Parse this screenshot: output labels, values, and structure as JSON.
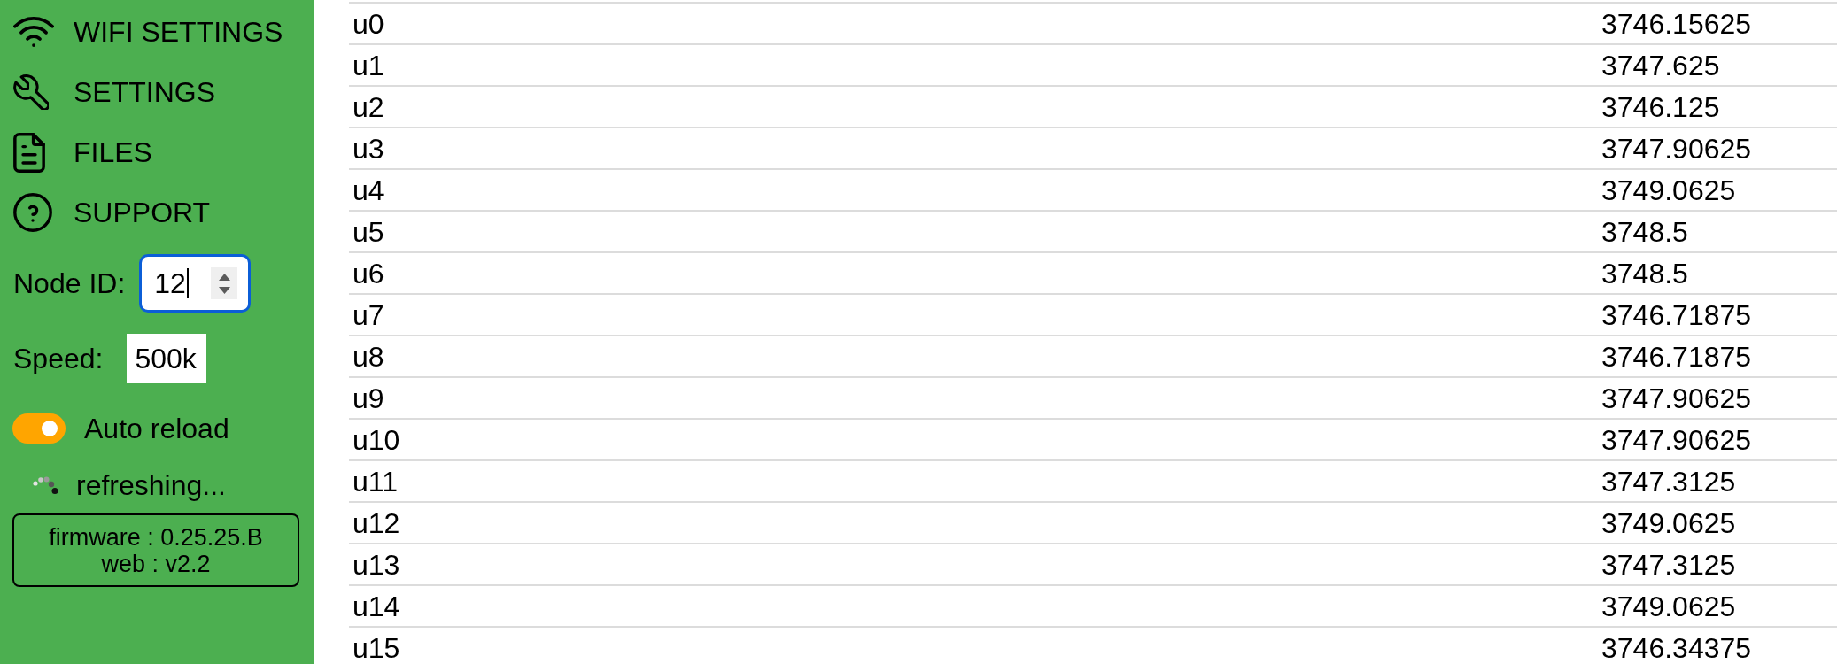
{
  "sidebar": {
    "nav_items": [
      {
        "kind": "wifi",
        "label": "WIFI SETTINGS"
      },
      {
        "kind": "wrench",
        "label": "SETTINGS"
      },
      {
        "kind": "document",
        "label": "FILES"
      },
      {
        "kind": "help",
        "label": "SUPPORT"
      }
    ],
    "node_id": {
      "label": "Node ID:",
      "value": "12",
      "focused": true
    },
    "speed": {
      "label": "Speed:",
      "value": "500k"
    },
    "auto_reload": {
      "label": "Auto reload",
      "on": true
    },
    "status": {
      "text": "refreshing..."
    },
    "version_box": {
      "lines": [
        "firmware : 0.25.25.B",
        "web : v2.2"
      ]
    }
  },
  "table": {
    "rows": [
      {
        "cells": [
          "u0",
          "3746.15625"
        ]
      },
      {
        "cells": [
          "u1",
          "3747.625"
        ]
      },
      {
        "cells": [
          "u2",
          "3746.125"
        ]
      },
      {
        "cells": [
          "u3",
          "3747.90625"
        ]
      },
      {
        "cells": [
          "u4",
          "3749.0625"
        ]
      },
      {
        "cells": [
          "u5",
          "3748.5"
        ]
      },
      {
        "cells": [
          "u6",
          "3748.5"
        ]
      },
      {
        "cells": [
          "u7",
          "3746.71875"
        ]
      },
      {
        "cells": [
          "u8",
          "3746.71875"
        ]
      },
      {
        "cells": [
          "u9",
          "3747.90625"
        ]
      },
      {
        "cells": [
          "u10",
          "3747.90625"
        ]
      },
      {
        "cells": [
          "u11",
          "3747.3125"
        ]
      },
      {
        "cells": [
          "u12",
          "3749.0625"
        ]
      },
      {
        "cells": [
          "u13",
          "3747.3125"
        ]
      },
      {
        "cells": [
          "u14",
          "3749.0625"
        ]
      },
      {
        "cells": [
          "u15",
          "3746.34375"
        ]
      }
    ]
  }
}
